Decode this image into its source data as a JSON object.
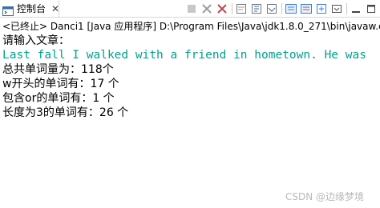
{
  "tab": {
    "label": "控制台",
    "icon": "console-icon",
    "close_icon": "close-icon",
    "close_glyph": "✕"
  },
  "toolbar": {
    "buttons": [
      "terminate-icon",
      "remove-all-terminated-icon",
      "clear-console-icon",
      "scroll-lock-icon",
      "word-wrap-icon",
      "show-console-on-output-icon",
      "show-console-on-error-icon",
      "open-console-icon",
      "display-selected-console-icon",
      "minimize-icon",
      "maximize-icon"
    ],
    "accent": "#3b7ddd"
  },
  "status": "<已终止> Danci1 [Java 应用程序] D:\\Program Files\\Java\\jdk1.8.0_271\\bin\\javaw.exe",
  "console": {
    "lines": [
      "请输入文章：",
      "Last fall I walked with a friend in hometown. He was",
      "总共单词量为：118个",
      "w开头的单词有：17 个",
      "包含or的单词有：1 个",
      "长度为3的单词有：26 个"
    ],
    "input_color": "#00a08a"
  },
  "watermark": "CSDN @边缘梦境"
}
